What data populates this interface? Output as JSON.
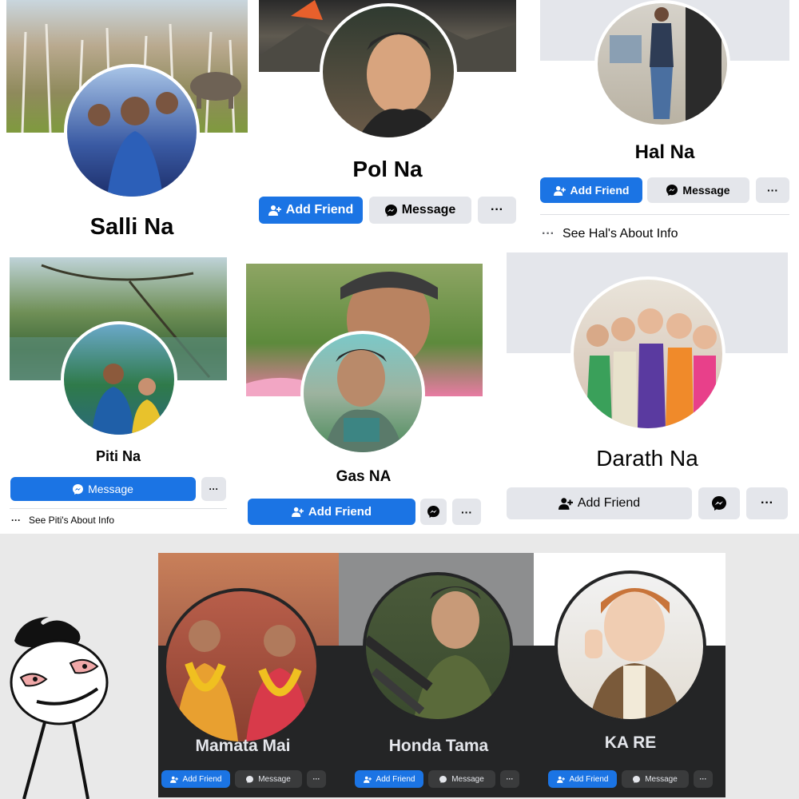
{
  "profiles": [
    {
      "name": "Salli Na"
    },
    {
      "name": "Pol Na",
      "add_friend": "Add Friend",
      "message": "Message",
      "more": "···"
    },
    {
      "name": "Hal Na",
      "add_friend": "Add Friend",
      "message": "Message",
      "more": "···",
      "about": "See Hal's About Info"
    },
    {
      "name": "Piti Na",
      "message": "Message",
      "more": "···",
      "about": "See Piti's About Info"
    },
    {
      "name": "Gas NA",
      "add_friend": "Add Friend",
      "more": "···"
    },
    {
      "name": "Darath Na",
      "add_friend": "Add Friend",
      "more": "···"
    },
    {
      "name": "Mamata Mai",
      "add_friend": "Add Friend",
      "message": "Message",
      "more": "···"
    },
    {
      "name": "Honda Tama",
      "add_friend": "Add Friend",
      "message": "Message",
      "more": "···"
    },
    {
      "name": "KA RE",
      "add_friend": "Add Friend",
      "message": "Message",
      "more": "···"
    }
  ],
  "icons": {
    "add_friend": "person-plus-icon",
    "messenger": "messenger-icon",
    "more": "more-dots-icon"
  },
  "colors": {
    "facebook_blue": "#1b74e4",
    "button_gray": "#e4e6eb",
    "dark_background": "#242526"
  }
}
